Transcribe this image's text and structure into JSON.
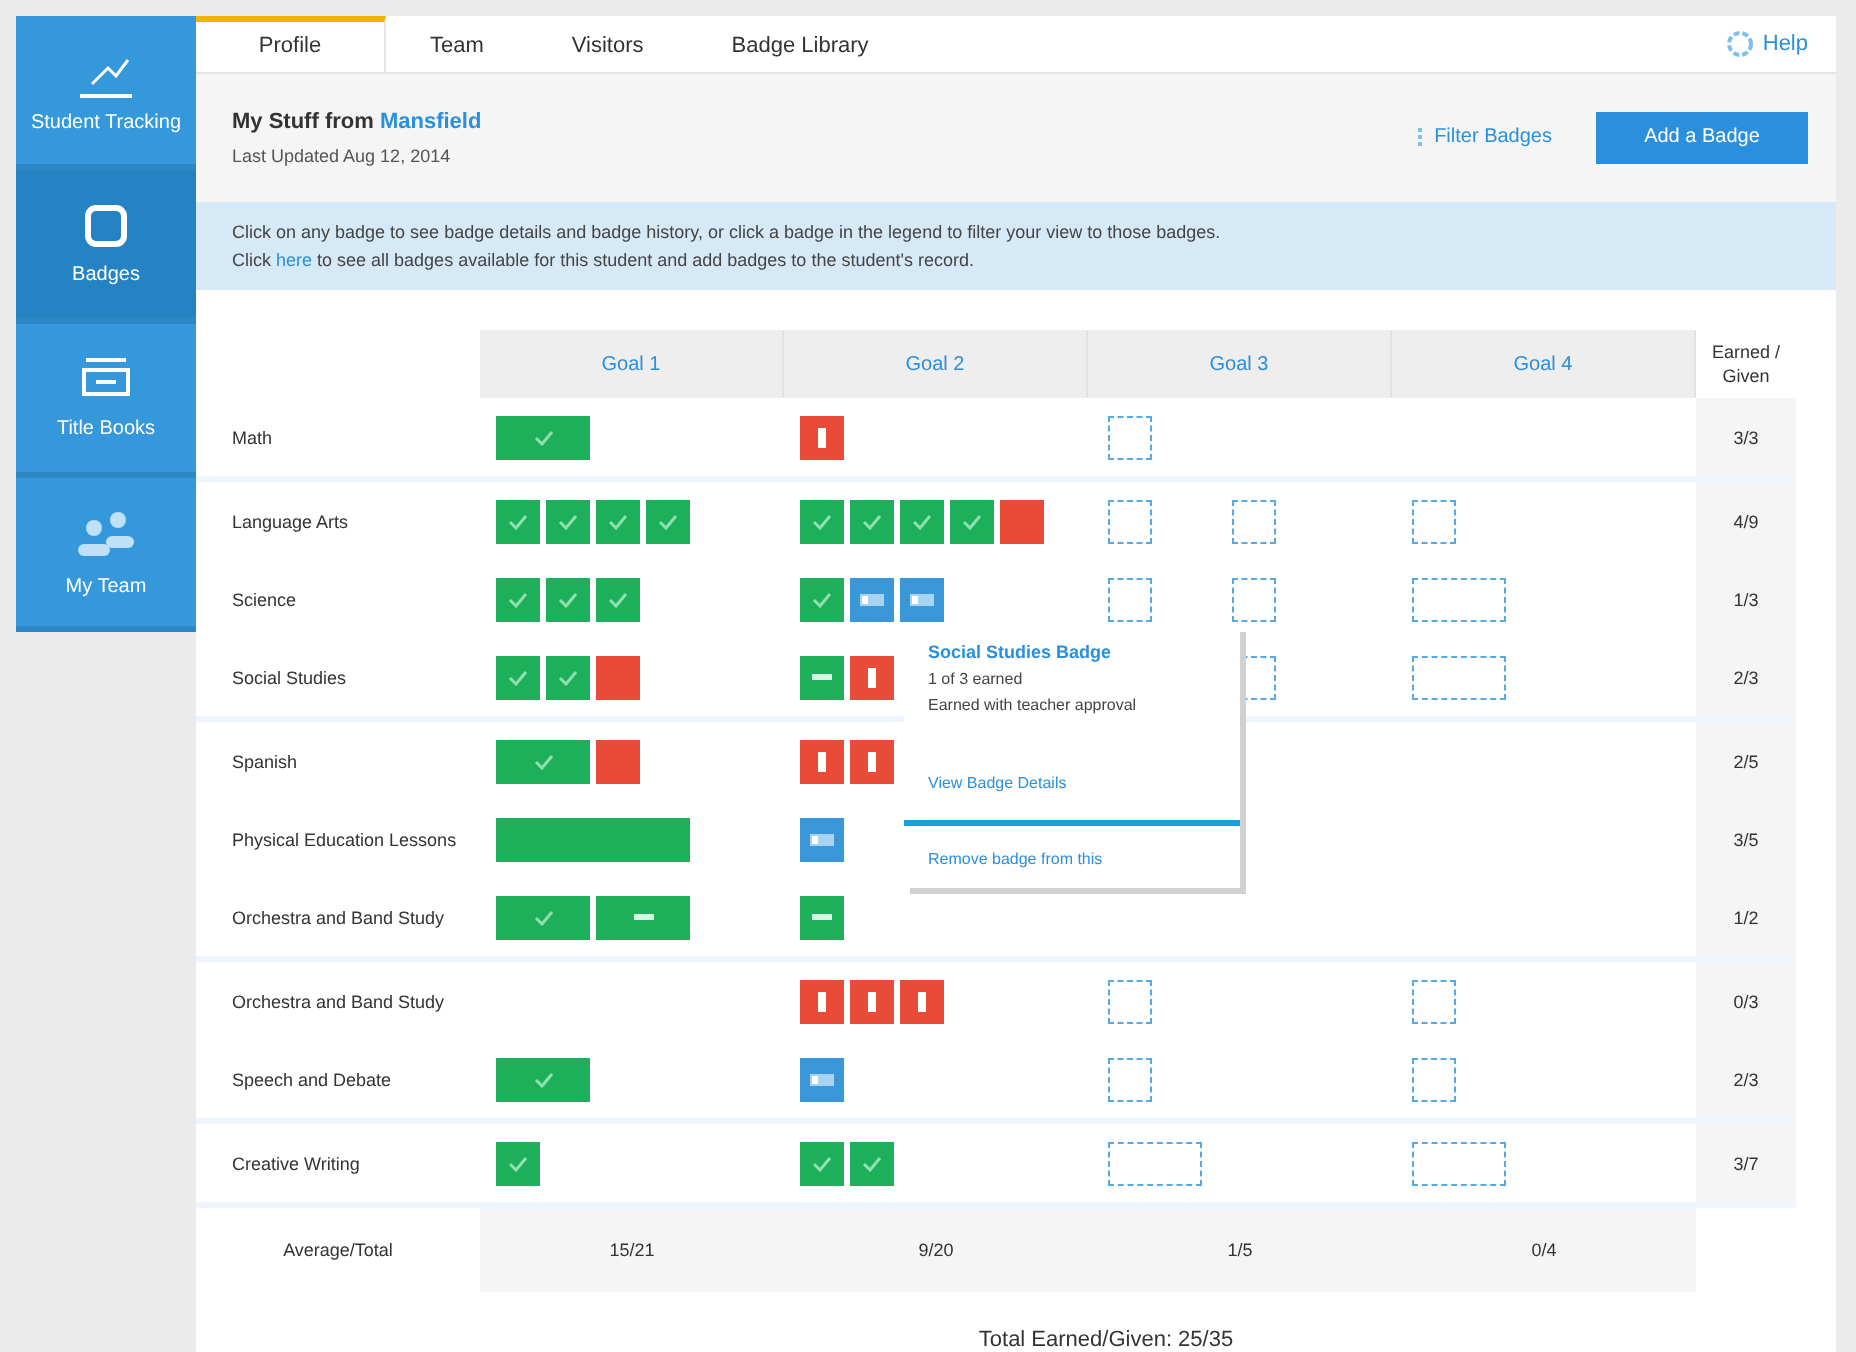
{
  "sidebar": {
    "items": [
      {
        "label": "Student Tracking",
        "selected": false
      },
      {
        "label": "Badges",
        "selected": true
      },
      {
        "label": "Title Books",
        "selected": false
      },
      {
        "label": "My Team",
        "selected": false
      }
    ]
  },
  "tabs": [
    {
      "label": "Profile",
      "selected": true
    },
    {
      "label": "Team",
      "selected": false
    },
    {
      "label": "Visitors",
      "selected": false
    },
    {
      "label": "Badge Library",
      "selected": false
    }
  ],
  "help": {
    "label": "Help"
  },
  "header": {
    "title": "My Stuff from",
    "title_link": "Mansfield",
    "subtitle": "Last Updated Aug 12, 2014",
    "filter_link": "Filter Badges",
    "add_button": "Add a Badge"
  },
  "banner": {
    "line_1": "Click on any badge to see badge details and badge history, or click a badge in the legend to filter your view to those badges.",
    "line_2_before": "Click",
    "line_2_link": "here",
    "line_2_after": "to see all badges available for this student and add badges to the student's record."
  },
  "table": {
    "columns": [
      "Goal 1",
      "Goal 2",
      "Goal 3",
      "Goal 4"
    ],
    "score_heading": "Earned / Given",
    "rows": [
      {
        "name": "Math",
        "score": "3/3",
        "goal_1": [
          {
            "kind": "pair"
          }
        ],
        "goal_2": [
          {
            "kind": "failed"
          }
        ],
        "goal_3": [
          {
            "kind": "slot"
          }
        ]
      },
      {
        "name": "Language Arts",
        "score": "4/9",
        "goal_1": [
          {
            "kind": "earned"
          },
          {
            "kind": "earned"
          },
          {
            "kind": "earned"
          },
          {
            "kind": "earned"
          }
        ],
        "goal_2": [
          {
            "kind": "earned"
          },
          {
            "kind": "earned"
          },
          {
            "kind": "earned"
          },
          {
            "kind": "earned"
          },
          {
            "kind": "missed"
          }
        ],
        "goal_3": [
          {
            "kind": "slot"
          },
          {
            "kind": "slot"
          }
        ],
        "goal_4": [
          {
            "kind": "slot"
          }
        ]
      },
      {
        "name": "Science",
        "score": "1/3",
        "goal_1": [
          {
            "kind": "earned"
          },
          {
            "kind": "earned"
          },
          {
            "kind": "earned"
          }
        ],
        "goal_2": [
          {
            "kind": "earned"
          },
          {
            "kind": "progress"
          },
          {
            "kind": "progress"
          }
        ],
        "goal_3": [
          {
            "kind": "slot"
          },
          {
            "kind": "slot"
          }
        ],
        "goal_4": [
          {
            "kind": "wideslot"
          }
        ]
      },
      {
        "name": "Social Studies",
        "score": "2/3",
        "goal_1": [
          {
            "kind": "earned"
          },
          {
            "kind": "earned"
          },
          {
            "kind": "missed"
          }
        ],
        "goal_2": [
          {
            "kind": "partial"
          },
          {
            "kind": "failed"
          }
        ],
        "goal_3": [
          {
            "kind": "trailslot"
          }
        ],
        "goal_4": [
          {
            "kind": "wideslot"
          }
        ]
      },
      {
        "name": "Spanish",
        "score": "2/5",
        "goal_1": [
          {
            "kind": "pair"
          },
          {
            "kind": "missed"
          }
        ],
        "goal_2": [
          {
            "kind": "failed"
          },
          {
            "kind": "failed"
          }
        ]
      },
      {
        "name": "Physical Education Lessons",
        "score": "3/5",
        "goal_1": [
          {
            "kind": "band"
          }
        ],
        "goal_2": [
          {
            "kind": "progress"
          }
        ]
      },
      {
        "name": "Orchestra and Band Study",
        "score": "1/2",
        "goal_1": [
          {
            "kind": "pair"
          },
          {
            "kind": "pairpartial"
          }
        ],
        "goal_2": [
          {
            "kind": "partial"
          }
        ]
      },
      {
        "name": "Orchestra and Band Study",
        "score": "0/3",
        "goal_2": [
          {
            "kind": "failed"
          },
          {
            "kind": "failed"
          },
          {
            "kind": "failed"
          }
        ],
        "goal_3": [
          {
            "kind": "slot"
          }
        ],
        "goal_4": [
          {
            "kind": "slot"
          }
        ]
      },
      {
        "name": "Speech and Debate",
        "score": "2/3",
        "goal_1": [
          {
            "kind": "pair"
          }
        ],
        "goal_2": [
          {
            "kind": "progress"
          }
        ],
        "goal_3": [
          {
            "kind": "slot"
          }
        ],
        "goal_4": [
          {
            "kind": "slot"
          }
        ]
      },
      {
        "name": "Creative Writing",
        "score": "3/7",
        "goal_1": [
          {
            "kind": "earned"
          }
        ],
        "goal_2": [
          {
            "kind": "earned"
          },
          {
            "kind": "earned"
          }
        ],
        "goal_3": [
          {
            "kind": "wideslot"
          }
        ],
        "goal_4": [
          {
            "kind": "wideslot"
          }
        ]
      }
    ],
    "totals_label": "Average/Total",
    "totals": [
      "15/21",
      "9/20",
      "1/5",
      "0/4"
    ]
  },
  "footer": "Total Earned/Given: 25/35",
  "popover": {
    "title": "Social Studies Badge",
    "line_1": "1 of 3 earned",
    "line_2": "Earned with teacher approval",
    "details_link": "View Badge Details",
    "remove_link": "Remove badge from this"
  }
}
